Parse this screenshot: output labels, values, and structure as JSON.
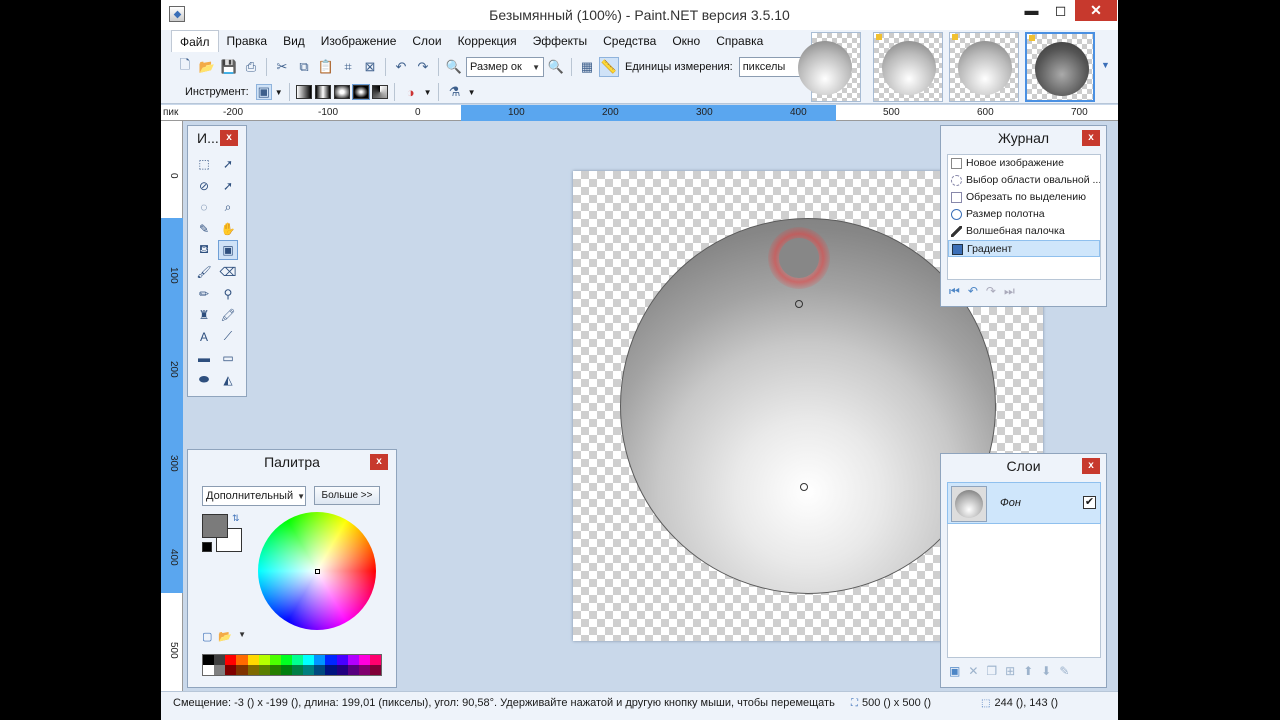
{
  "window": {
    "title": "Безымянный (100%) - Paint.NET версия 3.5.10",
    "min": "▬",
    "max": "◻",
    "close": "✕"
  },
  "menu": [
    "Файл",
    "Правка",
    "Вид",
    "Изображение",
    "Слои",
    "Коррекция",
    "Эффекты",
    "Средства",
    "Окно",
    "Справка"
  ],
  "toolbar": {
    "zoom_combo": "Размер ок",
    "units_label": "Единицы измерения:",
    "units_value": "пикселы",
    "tool_label": "Инструмент:"
  },
  "rulers": {
    "unit": "пик",
    "h_labels": [
      "-200",
      "-100",
      "0",
      "100",
      "200",
      "300",
      "400",
      "500",
      "600",
      "700"
    ],
    "v_labels": [
      "0",
      "100",
      "200",
      "300",
      "400",
      "500"
    ]
  },
  "tools_panel": {
    "title": "И..."
  },
  "history": {
    "title": "Журнал",
    "items": [
      "Новое изображение",
      "Выбор области овальной ...",
      "Обрезать по выделению",
      "Размер полотна",
      "Волшебная палочка",
      "Градиент"
    ],
    "selected_index": 5
  },
  "layers": {
    "title": "Слои",
    "items": [
      {
        "name": "Фон",
        "visible": true
      }
    ]
  },
  "palette": {
    "title": "Палитра",
    "mode": "Дополнительный",
    "more_button": "Больше >>",
    "primary_color": "#7b7b7b",
    "secondary_color": "#ffffff",
    "swatches_top": [
      "#000000",
      "#404040",
      "#ff0000",
      "#ff6a00",
      "#ffd800",
      "#b6ff00",
      "#4cff00",
      "#00ff21",
      "#00ff90",
      "#00ffff",
      "#0094ff",
      "#0026ff",
      "#4800ff",
      "#b200ff",
      "#ff00dc",
      "#ff006e"
    ],
    "swatches_bottom": [
      "#ffffff",
      "#808080",
      "#7f0000",
      "#7f3300",
      "#7f6a00",
      "#5b7f00",
      "#267f00",
      "#007f0e",
      "#007f46",
      "#007f7f",
      "#004a7f",
      "#00137f",
      "#21007f",
      "#57007f",
      "#7f006e",
      "#7f0037"
    ]
  },
  "status": {
    "message": "Смещение: -3 () х -199 (), длина: 199,01 (пикселы), угол: 90,58°. Удерживайте нажатой и другую кнопку мыши, чтобы перемещать",
    "image_size": "500 () x 500 ()",
    "cursor_pos": "244 (), 143 ()"
  }
}
